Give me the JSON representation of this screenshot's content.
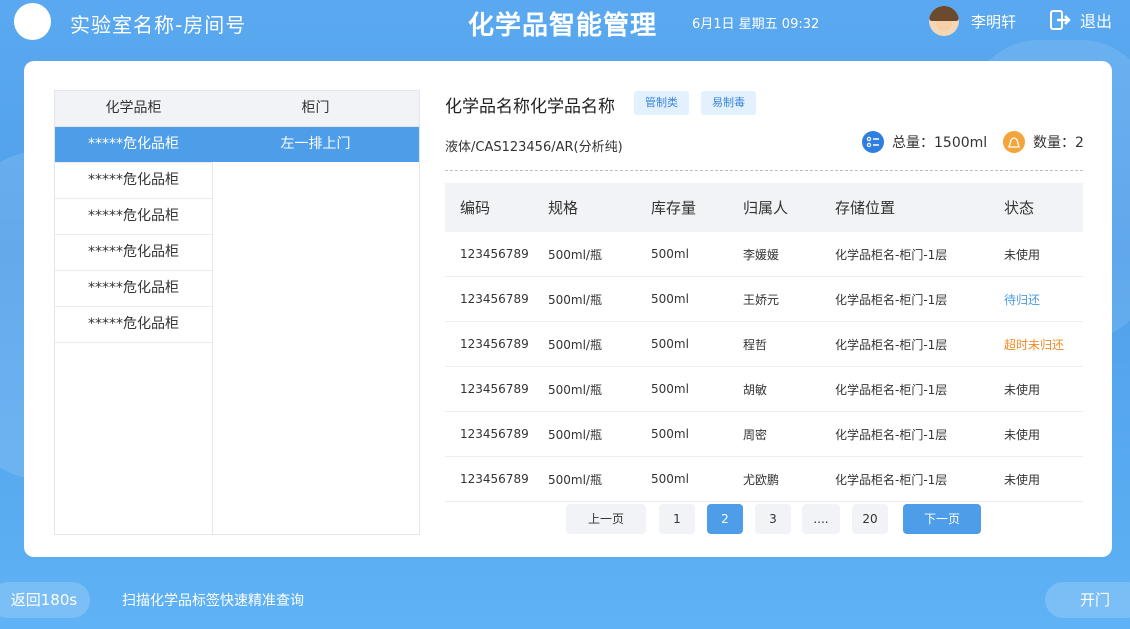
{
  "header": {
    "room": "实验室名称-房间号",
    "title": "化学品智能管理",
    "datetime": "6月1日  星期五  09:32",
    "user": "李明轩",
    "logout": "退出"
  },
  "left": {
    "col_cabinet": "化学品柜",
    "col_door": "柜门",
    "cabinets": [
      {
        "label": "*****危化品柜",
        "active": true
      },
      {
        "label": "*****危化品柜",
        "active": false
      },
      {
        "label": "*****危化品柜",
        "active": false
      },
      {
        "label": "*****危化品柜",
        "active": false
      },
      {
        "label": "*****危化品柜",
        "active": false
      },
      {
        "label": "*****危化品柜",
        "active": false
      }
    ],
    "doors": [
      {
        "label": "左一排上门",
        "active": true
      }
    ]
  },
  "chemical": {
    "name": "化学品名称化学品名称",
    "tags": [
      "管制类",
      "易制毒"
    ],
    "desc": "液体/CAS123456/AR(分析纯)",
    "total_label": "总量：1500ml",
    "count_label": "数量：2"
  },
  "table": {
    "headers": [
      "编码",
      "规格",
      "库存量",
      "归属人",
      "存储位置",
      "状态"
    ],
    "rows": [
      [
        "123456789",
        "500ml/瓶",
        "500ml",
        "李媛媛",
        "化学品柜名-柜门-1层",
        "未使用"
      ],
      [
        "123456789",
        "500ml/瓶",
        "500ml",
        "王娇元",
        "化学品柜名-柜门-1层",
        "待归还"
      ],
      [
        "123456789",
        "500ml/瓶",
        "500ml",
        "程哲",
        "化学品柜名-柜门-1层",
        "超时未归还"
      ],
      [
        "123456789",
        "500ml/瓶",
        "500ml",
        "胡敏",
        "化学品柜名-柜门-1层",
        "未使用"
      ],
      [
        "123456789",
        "500ml/瓶",
        "500ml",
        "周密",
        "化学品柜名-柜门-1层",
        "未使用"
      ],
      [
        "123456789",
        "500ml/瓶",
        "500ml",
        "尤欧鹏",
        "化学品柜名-柜门-1层",
        "未使用"
      ]
    ],
    "status_colors": {
      "待归还": "#4a9ae6",
      "超时未归还": "#f08a24"
    }
  },
  "pagination": {
    "prev": "上一页",
    "next": "下一页",
    "pages": [
      "1",
      "2",
      "3",
      "....",
      "20"
    ],
    "current": "2"
  },
  "footer": {
    "back": "返回180s",
    "hint": "扫描化学品标签快速精准查询",
    "open": "开门"
  },
  "icons": [
    "logout-icon",
    "list-icon",
    "bag-icon"
  ]
}
